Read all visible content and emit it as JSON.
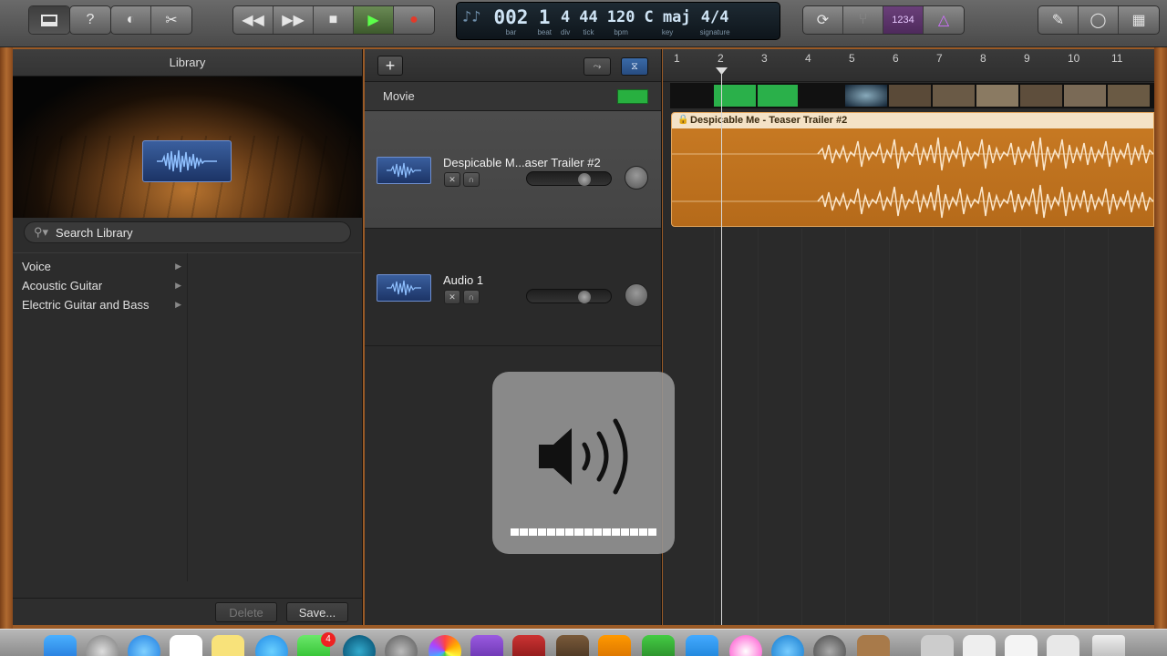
{
  "toolbar": {
    "left_buttons": [
      "library-icon",
      "help-icon",
      "smart-controls-icon",
      "editors-icon"
    ],
    "transport": [
      "rewind-icon",
      "fast-forward-icon",
      "stop-icon",
      "play-icon",
      "record-icon"
    ],
    "lcd": {
      "bar": "2",
      "bar_dim": "00",
      "bar_label": "bar",
      "beat": "1",
      "beat_label": "beat",
      "div": "4",
      "div_label": "div",
      "tick": "44",
      "tick_label": "tick",
      "bpm": "120",
      "bpm_label": "bpm",
      "key": "C maj",
      "key_label": "key",
      "signature": "4/4",
      "signature_label": "signature"
    },
    "count_in": "1234"
  },
  "library": {
    "title": "Library",
    "search_placeholder": "Search Library",
    "categories": [
      {
        "label": "Voice"
      },
      {
        "label": "Acoustic Guitar"
      },
      {
        "label": "Electric Guitar and Bass"
      }
    ],
    "delete_label": "Delete",
    "save_label": "Save..."
  },
  "tracks": {
    "add_label": "+",
    "movie_label": "Movie",
    "items": [
      {
        "name": "Despicable M...aser Trailer #2",
        "volume_fraction": 0.7
      },
      {
        "name": "Audio 1",
        "volume_fraction": 0.7
      }
    ]
  },
  "timeline": {
    "ruler": [
      "1",
      "2",
      "3",
      "4",
      "5",
      "6",
      "7",
      "8",
      "9",
      "10",
      "11"
    ],
    "region_title": "Despicable Me - Teaser Trailer #2",
    "playhead_bar": 2
  },
  "hud": {
    "volume_level": 1.0
  },
  "dock": {
    "mail_badge": "4"
  },
  "colors": {
    "region": "#c47a26",
    "play": "#5cff4a",
    "record": "#e23a2a",
    "accent_blue": "#3a6aa8"
  }
}
